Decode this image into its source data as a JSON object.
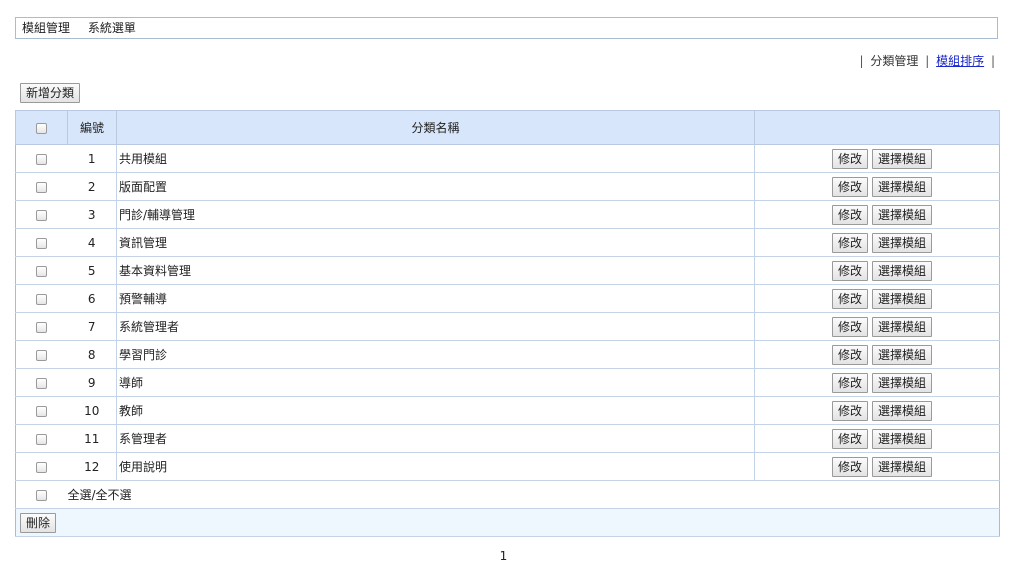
{
  "breadcrumb": {
    "item1": "模組管理",
    "item2": "系統選單"
  },
  "toplinks": {
    "left_sep": "|",
    "category_manage": "分類管理",
    "mid_sep": "|",
    "module_sort": "模組排序",
    "right_sep": "|"
  },
  "toolbar": {
    "add_category": "新增分類"
  },
  "table": {
    "headers": {
      "number": "編號",
      "name": "分類名稱"
    },
    "edit_label": "修改",
    "select_label": "選擇模組",
    "rows": [
      {
        "num": "1",
        "name": "共用模組"
      },
      {
        "num": "2",
        "name": "版面配置"
      },
      {
        "num": "3",
        "name": "門診/輔導管理"
      },
      {
        "num": "4",
        "name": "資訊管理"
      },
      {
        "num": "5",
        "name": "基本資料管理"
      },
      {
        "num": "6",
        "name": "預警輔導"
      },
      {
        "num": "7",
        "name": "系統管理者"
      },
      {
        "num": "8",
        "name": "學習門診"
      },
      {
        "num": "9",
        "name": "導師"
      },
      {
        "num": "10",
        "name": "教師"
      },
      {
        "num": "11",
        "name": "系管理者"
      },
      {
        "num": "12",
        "name": "使用說明"
      }
    ],
    "select_all": "全選/全不選",
    "delete_label": "刪除"
  },
  "pagination": {
    "current": "1"
  }
}
